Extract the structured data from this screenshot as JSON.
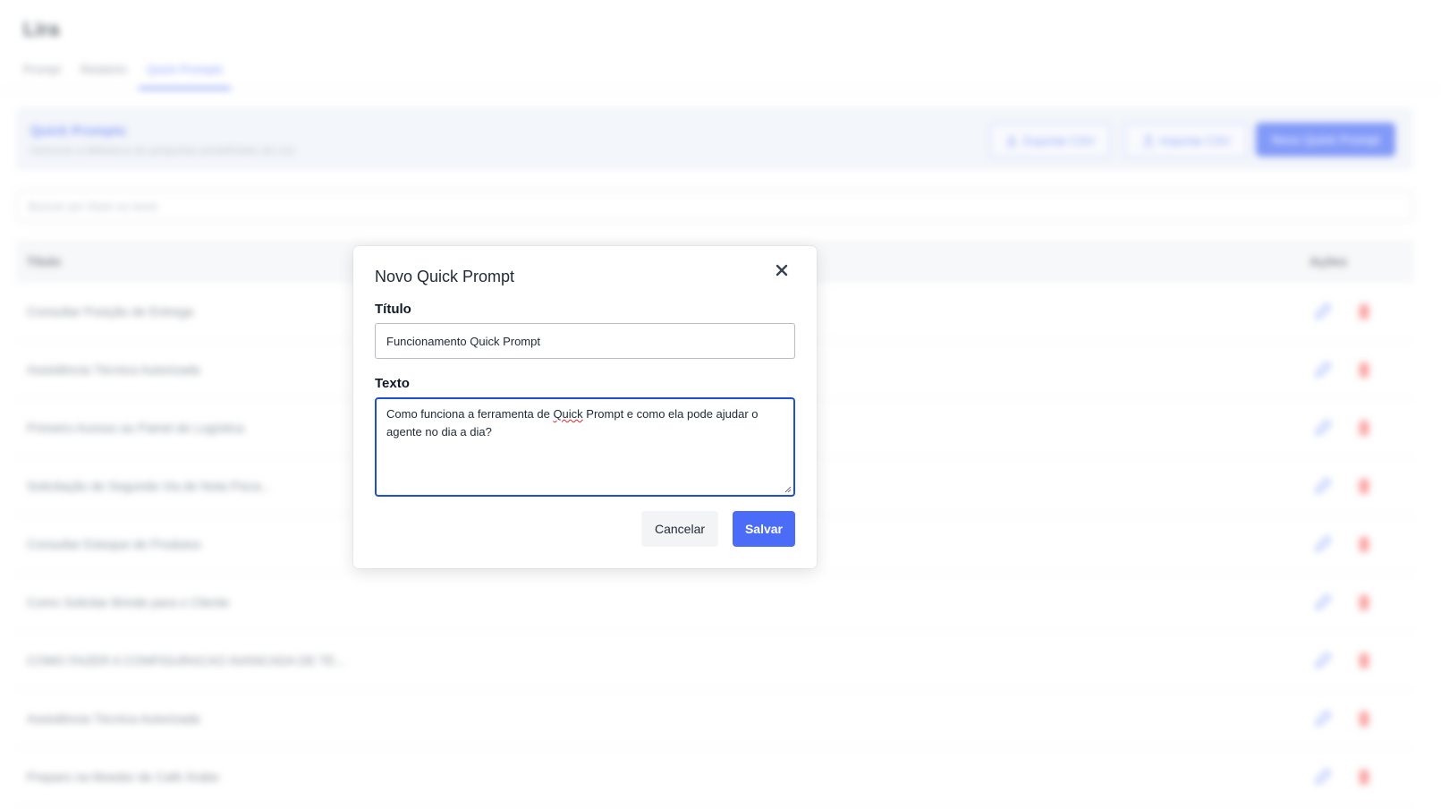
{
  "app": {
    "title": "Lira",
    "tabs": [
      {
        "label": "Prompt",
        "active": false
      },
      {
        "label": "Relatório",
        "active": false
      },
      {
        "label": "Quick Prompts",
        "active": true
      }
    ]
  },
  "header": {
    "title": "Quick Prompts",
    "subtitle": "Gerencie a biblioteca de perguntas predefinidas da Lira",
    "export_label": "Exportar CSV",
    "import_label": "Importar CSV",
    "new_label": "Novo Quick Prompt"
  },
  "search": {
    "placeholder": "Buscar por título ou texto"
  },
  "table": {
    "col_title": "Título",
    "col_actions": "Ações",
    "rows": [
      "Consultar Posição de Entrega",
      "Assistência Técnica Autorizada",
      "Primeiro Acesso ao Painel de Logística",
      "Solicitação de Segunda Via de Nota Fisca...",
      "Consultar Estoque de Produtos",
      "Como Solicitar Brinde para o Cliente",
      "COMO FAZER A CONFIGURACAO AVANCADA DE TE...",
      "Assistência Técnica Autorizada",
      "Preparo na Moedor de Café Árabe"
    ]
  },
  "colors": {
    "accent": "#4a6cf7",
    "danger": "#f87171",
    "edit": "#6b8cf7"
  },
  "modal": {
    "title": "Novo Quick Prompt",
    "title_label": "Título",
    "title_value": "Funcionamento Quick Prompt",
    "text_label": "Texto",
    "text_value_before": "Como funciona a ferramenta de ",
    "text_value_misspelled": "Quick",
    "text_value_after": " Prompt e como ela pode ajudar o agente no dia a dia?",
    "cancel_label": "Cancelar",
    "save_label": "Salvar",
    "close_icon": "close-icon"
  }
}
